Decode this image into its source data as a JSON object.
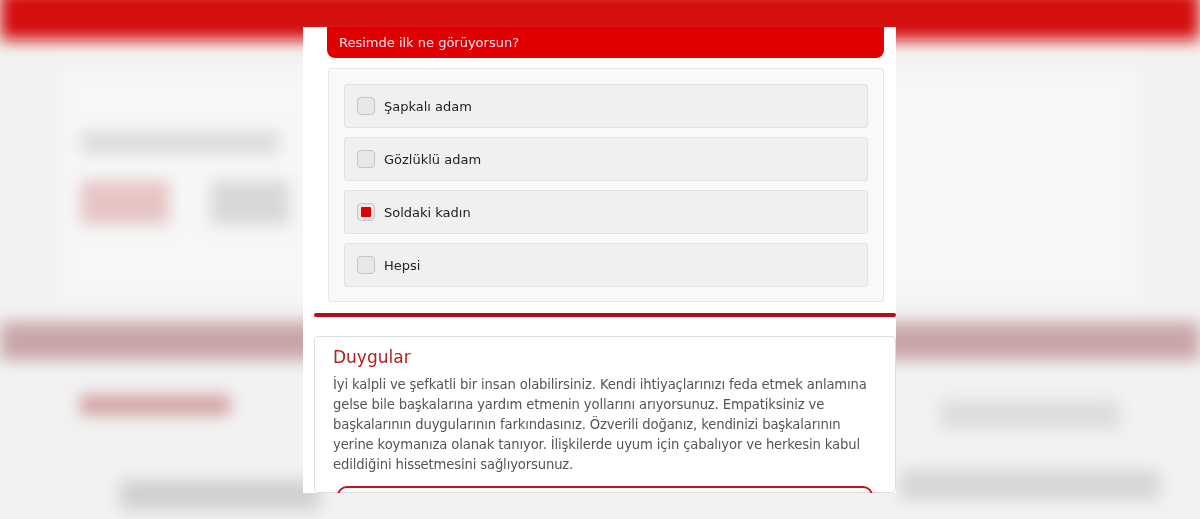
{
  "question": {
    "title": "Resimde ilk ne görüyorsun?",
    "options": [
      {
        "label": "Şapkalı adam",
        "selected": false
      },
      {
        "label": "Gözlüklü adam",
        "selected": false
      },
      {
        "label": "Soldaki kadın",
        "selected": true
      },
      {
        "label": "Hepsi",
        "selected": false
      }
    ]
  },
  "result": {
    "title": "Duygular",
    "text": "İyi kalpli ve şefkatli bir insan olabilirsiniz. Kendi ihtiyaçlarınızı feda etmek anlamına gelse bile başkalarına yardım etmenin yollarını arıyorsunuz. Empatiksiniz ve başkalarının duygularının farkındasınız. Özverili doğanız, kendinizi başkalarının yerine koymanıza olanak tanıyor. İlişkilerde uyum için çabalıyor ve herkesin kabul edildiğini hissetmesini sağlıyorsunuz."
  }
}
